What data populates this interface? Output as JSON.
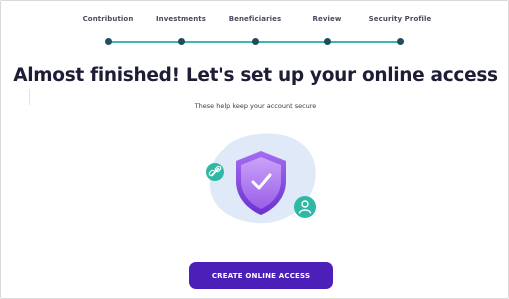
{
  "stepper": {
    "steps": [
      {
        "label": "Contribution"
      },
      {
        "label": "Investments"
      },
      {
        "label": "Beneficiaries"
      },
      {
        "label": "Review"
      },
      {
        "label": "Security Profile"
      }
    ]
  },
  "main": {
    "title": "Almost finished! Let's set up your online access",
    "subtitle": "These help keep your account secure"
  },
  "cta": {
    "label": "CREATE ONLINE ACCESS"
  },
  "illustration": {
    "icons": [
      "shield-check-icon",
      "link-icon",
      "user-icon"
    ]
  },
  "colors": {
    "accent": "#4b1fb8",
    "stepper_line": "#3fb8b0",
    "stepper_dot": "#1e4f5a",
    "shield": "#8a4fe0",
    "blob": "#dfe9f7",
    "badge": "#2fb8a6"
  }
}
